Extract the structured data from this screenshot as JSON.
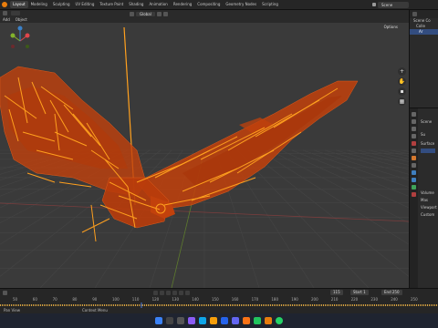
{
  "menubar": {
    "tabs": [
      "Layout",
      "Modeling",
      "Sculpting",
      "UV Editing",
      "Texture Paint",
      "Shading",
      "Animation",
      "Rendering",
      "Compositing",
      "Geometry Nodes",
      "Scripting"
    ],
    "active_tab": "Layout",
    "scene": "Scene"
  },
  "viewport_header": {
    "menus": [
      "Add",
      "Object"
    ],
    "orientation": "Global",
    "options": "Options"
  },
  "outliner": {
    "rows": [
      "Scene Co",
      "Colle",
      "Ar"
    ]
  },
  "properties": {
    "lines": [
      "Scene",
      "Su",
      "Surface",
      "Volume",
      "Mas",
      "Viewport",
      "Custom"
    ]
  },
  "timeline": {
    "frame_start_label": "Start",
    "frame_start": "1",
    "frame_end_label": "End",
    "frame_end": "250",
    "current_frame": "115",
    "ticks": [
      "50",
      "60",
      "70",
      "80",
      "90",
      "100",
      "110",
      "120",
      "130",
      "140",
      "150",
      "160",
      "170",
      "180",
      "190",
      "200",
      "210",
      "220",
      "230",
      "240",
      "250"
    ]
  },
  "statusbar": {
    "left": "Pan View",
    "middle": "Context Menu"
  },
  "colors": {
    "accent": "#e87d0d",
    "mesh": "#c2410c",
    "bone": "#ffa01e",
    "selected": "#334d80",
    "taskbar": "#1f2430"
  }
}
